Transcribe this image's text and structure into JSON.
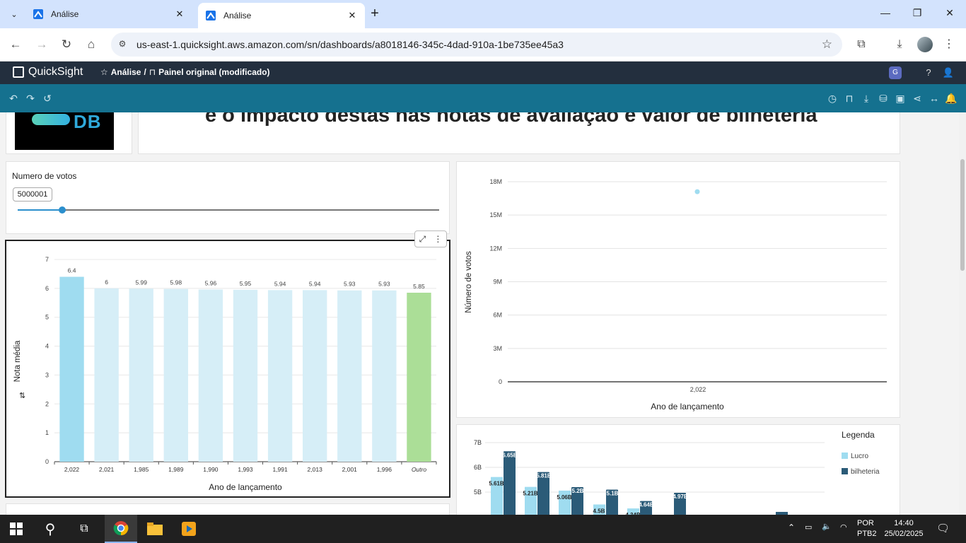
{
  "browser": {
    "tabs": [
      {
        "title": "Análise",
        "active": false
      },
      {
        "title": "Análise",
        "active": true
      }
    ],
    "url": "us-east-1.quicksight.aws.amazon.com/sn/dashboards/a8018146-345c-4dad-910a-1be735ee45a3"
  },
  "quicksight": {
    "brand": "QuickSight",
    "breadcrumb_analysis": "Análise",
    "breadcrumb_sep": "/",
    "breadcrumb_sheet": "Painel original (modificado)"
  },
  "header": {
    "logo_text": "DB",
    "title": "e o impacto destas nas notas de avaliação e valor de bilheteria"
  },
  "control": {
    "label": "Numero de votos",
    "value": "5000001",
    "slider_fraction": 0.106
  },
  "colors": {
    "bar_highlight": "#9fdcf0",
    "bar_normal": "#d6eef7",
    "bar_other": "#abde97",
    "scatter_point": "#9fdcf0",
    "lucro": "#9fdcf0",
    "bilheteria": "#2b5b78",
    "qs_toolbar": "#15718f"
  },
  "chart_data": [
    {
      "type": "bar",
      "categories": [
        "2,022",
        "2,021",
        "1,985",
        "1,989",
        "1,990",
        "1,993",
        "1,991",
        "2,013",
        "2,001",
        "1,996",
        "Outro"
      ],
      "values": [
        6.4,
        6,
        5.99,
        5.98,
        5.96,
        5.95,
        5.94,
        5.94,
        5.93,
        5.93,
        5.85
      ],
      "value_labels": [
        "6.4",
        "6",
        "5.99",
        "5.98",
        "5.96",
        "5.95",
        "5.94",
        "5.94",
        "5.93",
        "5.93",
        "5.85"
      ],
      "ylim": [
        0,
        7
      ],
      "yticks": [
        "0",
        "1",
        "2",
        "3",
        "4",
        "5",
        "6",
        "7"
      ],
      "xlabel": "Ano de lançamento",
      "ylabel": "Nota média",
      "grid": true
    },
    {
      "type": "scatter",
      "x": [
        "2,022"
      ],
      "y": [
        17100000
      ],
      "ylim": [
        0,
        18000000
      ],
      "yticks": [
        "0",
        "3M",
        "6M",
        "9M",
        "12M",
        "15M",
        "18M"
      ],
      "xticks": [
        "2,022"
      ],
      "xlabel": "Ano de lançamento",
      "ylabel": "Número de votos",
      "grid": true
    },
    {
      "type": "bar",
      "legend_title": "Legenda",
      "legend_position": "right",
      "series": [
        {
          "name": "Lucro",
          "values": [
            5.61,
            5.21,
            5.06,
            4.5,
            4.34
          ]
        },
        {
          "name": "bilheteria",
          "values": [
            6.65,
            5.81,
            5.2,
            5.1,
            4.64,
            4.97
          ]
        }
      ],
      "lucro_labels": [
        "5.61B",
        "5.21B",
        "5.06B",
        "4.5B",
        "4.34B"
      ],
      "bilheteria_labels": [
        "6.65B",
        "5.81B",
        "5.2B",
        "5.1B",
        "4.64B",
        "4.97B"
      ],
      "yticks": [
        "5B",
        "6B",
        "7B"
      ],
      "grid": true
    }
  ],
  "taskbar": {
    "lang_top": "POR",
    "lang_bottom": "PTB2",
    "time": "14:40",
    "date": "25/02/2025"
  }
}
